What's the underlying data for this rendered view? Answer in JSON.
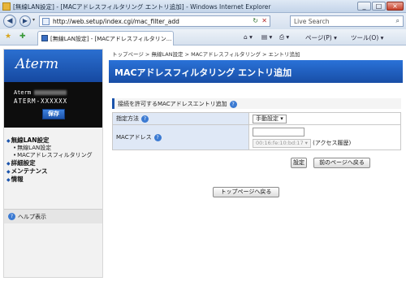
{
  "window": {
    "title": "[無線LAN設定] - [MACアドレスフィルタリング エントリ追加] - Windows Internet Explorer",
    "controls": [
      "_",
      "□",
      "×"
    ]
  },
  "address_bar": {
    "back_icon": "back-arrow-icon",
    "forward_icon": "forward-arrow-icon",
    "url": "http://web.setup/index.cgi/mac_filter_add",
    "search_placeholder": "Live Search"
  },
  "tab": {
    "label": "[無線LAN設定] - [MACアドレスフィルタリン..."
  },
  "toolbar": {
    "home_label": "⌂ ▾",
    "feeds_label": "▤ ▾",
    "print_label": "⎙ ▾",
    "page_label": "ページ(P) ▾",
    "tools_label": "ツール(O) ▾"
  },
  "sidebar": {
    "logo": "Aterm",
    "device_line1": "Aterm",
    "device_line2": "ATERM-XXXXXX",
    "save_label": "保存",
    "menu": [
      {
        "label": "無線LAN設定",
        "subs": [
          "無線LAN設定",
          "MACアドレスフィルタリング"
        ]
      },
      {
        "label": "詳細設定",
        "subs": []
      },
      {
        "label": "メンテナンス",
        "subs": []
      },
      {
        "label": "情報",
        "subs": []
      }
    ],
    "help_label": "ヘルプ表示"
  },
  "main": {
    "breadcrumb": "トップページ > 無線LAN設定 > MACアドレスフィルタリング > エントリ追加",
    "heading": "MACアドレスフィルタリング エントリ追加",
    "section_title": "接続を許可するMACアドレスエントリ追加",
    "form": {
      "method_label": "指定方法",
      "method_value": "手動設定",
      "mac_label": "MACアドレス",
      "mac_value": "",
      "history_value": "00:16:fe:10:bd:17",
      "history_label": "(アクセス履歴)"
    },
    "buttons": {
      "submit": "設定",
      "back": "前のページへ戻る",
      "top": "トップページへ戻る"
    }
  }
}
